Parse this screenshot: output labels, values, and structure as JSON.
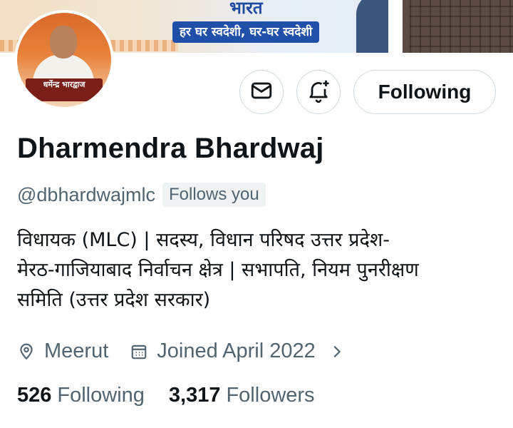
{
  "banner": {
    "title": "भारत",
    "slogan": "हर घर स्वदेशी, घर-घर स्वदेशी"
  },
  "avatar": {
    "name_tag": "धर्मेन्द्र भारद्वाज"
  },
  "actions": {
    "message_icon": "mail-icon",
    "notify_icon": "bell-plus-icon",
    "follow_label": "Following"
  },
  "profile": {
    "display_name": "Dharmendra Bhardwaj",
    "handle": "@dbhardwajmlc",
    "follows_you": "Follows you",
    "bio_lines": [
      "विधायक (MLC) | सदस्य, विधान परिषद उत्तर प्रदेश-",
      "मेरठ-गाजियाबाद निर्वाचन क्षेत्र | सभापति, नियम पुनरीक्षण",
      "समिति (उत्तर प्रदेश सरकार)"
    ],
    "location": "Meerut",
    "joined": "Joined April 2022"
  },
  "stats": {
    "following_count": "526",
    "following_label": "Following",
    "followers_count": "3,317",
    "followers_label": "Followers"
  },
  "colors": {
    "text": "#0f1419",
    "secondary": "#536471",
    "border": "#cfd9de"
  }
}
